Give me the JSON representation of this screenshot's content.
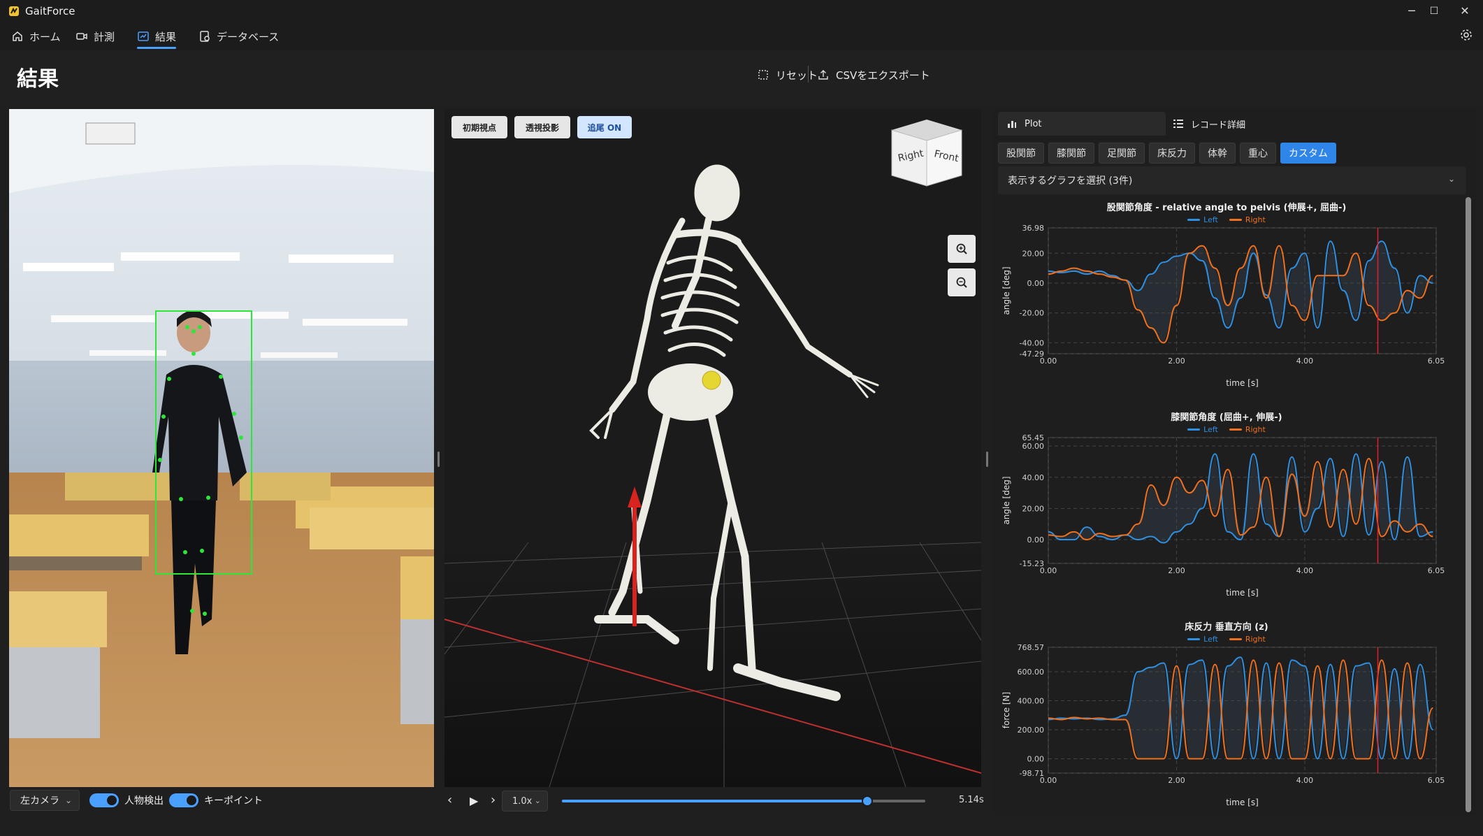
{
  "app": {
    "title": "GaitForce"
  },
  "window": {
    "minimize": "─",
    "maximize": "☐",
    "close": "✕"
  },
  "nav": [
    {
      "label": "ホーム",
      "icon": "home-icon"
    },
    {
      "label": "計測",
      "icon": "camera-icon"
    },
    {
      "label": "結果",
      "icon": "results-icon",
      "active": true
    },
    {
      "label": "データベース",
      "icon": "database-icon"
    }
  ],
  "page": {
    "title": "結果",
    "reset_label": "リセット",
    "export_label": "CSVをエクスポート"
  },
  "camera": {
    "select_value": "左カメラ",
    "person_detection_label": "人物検出",
    "person_detection_on": true,
    "keypoints_label": "キーポイント",
    "keypoints_on": true
  },
  "viewer": {
    "initial_view_label": "初期視点",
    "perspective_label": "透視投影",
    "follow_label": "追尾 ON",
    "cube_right": "Right",
    "cube_front": "Front"
  },
  "playback": {
    "speed_value": "1.0x",
    "time_label": "5.14s",
    "progress_fraction": 0.84
  },
  "panel": {
    "tab_plot": "Plot",
    "tab_record": "レコード詳細",
    "categories": [
      "股関節",
      "膝関節",
      "足関節",
      "床反力",
      "体幹",
      "重心",
      "カスタム"
    ],
    "active_category": "カスタム",
    "graph_select_label": "表示するグラフを選択 (3件)"
  },
  "colors": {
    "accent": "#2f86e8",
    "left": "#2f8fe0",
    "right": "#f0701e",
    "cursor": "#e0202a"
  },
  "chart_data": [
    {
      "type": "line",
      "title": "股関節角度 - relative angle to pelvis (伸展+, 屈曲-)",
      "xlabel": "time [s]",
      "ylabel": "angle [deg]",
      "xlim": [
        0,
        6.05
      ],
      "ylim": [
        -47.29,
        36.98
      ],
      "xticks": [
        "0.00",
        "2.00",
        "4.00",
        "6.05"
      ],
      "yticks": [
        "36.98",
        "20.00",
        "0.00",
        "-20.00",
        "-40.00",
        "-47.29"
      ],
      "cursor_x": 5.14,
      "x": [
        0,
        0.2,
        0.4,
        0.6,
        0.8,
        1.0,
        1.2,
        1.4,
        1.6,
        1.8,
        2.0,
        2.2,
        2.4,
        2.6,
        2.8,
        3.0,
        3.2,
        3.4,
        3.6,
        3.8,
        4.0,
        4.2,
        4.4,
        4.6,
        4.8,
        5.0,
        5.2,
        5.4,
        5.6,
        5.8,
        6.0
      ],
      "series": [
        {
          "name": "Left",
          "values": [
            8,
            7,
            8,
            6,
            8,
            5,
            2,
            -5,
            6,
            14,
            18,
            20,
            15,
            -10,
            -30,
            -10,
            20,
            -8,
            -30,
            10,
            20,
            -30,
            28,
            -5,
            -25,
            15,
            28,
            10,
            -20,
            5,
            0
          ]
        },
        {
          "name": "Right",
          "values": [
            6,
            8,
            10,
            8,
            6,
            4,
            2,
            -18,
            -30,
            -40,
            -15,
            20,
            25,
            10,
            -15,
            10,
            25,
            -10,
            25,
            -15,
            -25,
            5,
            5,
            5,
            20,
            -15,
            -25,
            -20,
            -5,
            -10,
            5
          ]
        }
      ]
    },
    {
      "type": "line",
      "title": "膝関節角度 (屈曲+, 伸展-)",
      "xlabel": "time [s]",
      "ylabel": "angle [deg]",
      "xlim": [
        0,
        6.05
      ],
      "ylim": [
        -15.23,
        65.45
      ],
      "xticks": [
        "0.00",
        "2.00",
        "4.00",
        "6.05"
      ],
      "yticks": [
        "65.45",
        "60.00",
        "40.00",
        "20.00",
        "0.00",
        "-15.23"
      ],
      "cursor_x": 5.14,
      "x": [
        0,
        0.2,
        0.4,
        0.6,
        0.8,
        1.0,
        1.2,
        1.4,
        1.6,
        1.8,
        2.0,
        2.2,
        2.4,
        2.6,
        2.8,
        3.0,
        3.2,
        3.4,
        3.6,
        3.8,
        4.0,
        4.2,
        4.4,
        4.6,
        4.8,
        5.0,
        5.2,
        5.4,
        5.6,
        5.8,
        6.0
      ],
      "series": [
        {
          "name": "Left",
          "values": [
            5,
            0,
            0,
            8,
            2,
            0,
            3,
            0,
            2,
            -2,
            5,
            10,
            20,
            55,
            5,
            0,
            55,
            10,
            2,
            53,
            5,
            20,
            52,
            2,
            55,
            3,
            50,
            0,
            53,
            2,
            5
          ]
        },
        {
          "name": "Right",
          "values": [
            3,
            2,
            5,
            0,
            4,
            2,
            3,
            10,
            35,
            22,
            40,
            30,
            38,
            15,
            45,
            3,
            8,
            40,
            2,
            42,
            15,
            50,
            8,
            45,
            10,
            52,
            2,
            12,
            5,
            10,
            2
          ]
        }
      ]
    },
    {
      "type": "line",
      "title": "床反力 垂直方向 (z)",
      "xlabel": "time [s]",
      "ylabel": "force [N]",
      "xlim": [
        0,
        6.05
      ],
      "ylim": [
        -98.71,
        768.57
      ],
      "xticks": [
        "0.00",
        "2.00",
        "4.00",
        "6.05"
      ],
      "yticks": [
        "768.57",
        "600.00",
        "400.00",
        "200.00",
        "0.00",
        "-98.71"
      ],
      "cursor_x": 5.14,
      "x": [
        0,
        0.2,
        0.4,
        0.6,
        0.8,
        1.0,
        1.2,
        1.4,
        1.6,
        1.8,
        2.0,
        2.2,
        2.4,
        2.6,
        2.8,
        3.0,
        3.2,
        3.4,
        3.6,
        3.8,
        4.0,
        4.2,
        4.4,
        4.6,
        4.8,
        5.0,
        5.2,
        5.4,
        5.6,
        5.8,
        6.0
      ],
      "series": [
        {
          "name": "Left",
          "values": [
            270,
            280,
            275,
            280,
            270,
            275,
            300,
            600,
            630,
            660,
            0,
            650,
            680,
            0,
            640,
            700,
            0,
            660,
            0,
            680,
            640,
            0,
            650,
            0,
            640,
            660,
            0,
            620,
            0,
            650,
            200
          ]
        },
        {
          "name": "Right",
          "values": [
            280,
            270,
            285,
            275,
            280,
            270,
            270,
            0,
            0,
            0,
            640,
            0,
            0,
            650,
            0,
            0,
            680,
            0,
            660,
            0,
            0,
            640,
            0,
            680,
            0,
            0,
            680,
            0,
            660,
            0,
            350
          ]
        }
      ]
    }
  ]
}
